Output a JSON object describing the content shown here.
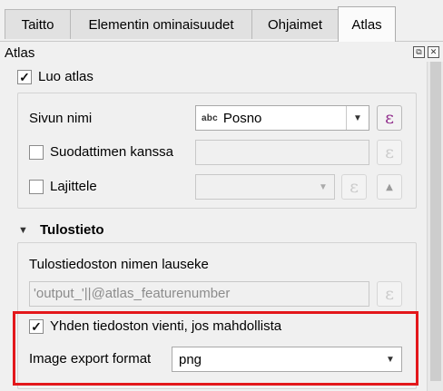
{
  "tabs": [
    {
      "label": "Taitto",
      "active": false
    },
    {
      "label": "Elementin ominaisuudet",
      "active": false
    },
    {
      "label": "Ohjaimet",
      "active": false
    },
    {
      "label": "Atlas",
      "active": true
    }
  ],
  "panel": {
    "title": "Atlas",
    "float_icon": "float-icon",
    "close_icon": "close-icon"
  },
  "generate": {
    "label": "Luo atlas",
    "checked": true
  },
  "page_name": {
    "label": "Sivun nimi",
    "value": "Posno",
    "type_badge": "abc"
  },
  "filter": {
    "label": "Suodattimen kanssa",
    "checked": false
  },
  "sort": {
    "label": "Lajittele",
    "checked": false
  },
  "expression_symbol": "ε",
  "output": {
    "section_title": "Tulostieto",
    "filename_label": "Tulostiedoston nimen lauseke",
    "filename_value": "'output_'||@atlas_featurenumber",
    "single_file": {
      "label": "Yhden tiedoston vienti, jos mahdollista",
      "checked": true
    },
    "format_label": "Image export format",
    "format_value": "png"
  },
  "colors": {
    "highlight": "#e3171b",
    "expression": "#8f2a8a"
  }
}
